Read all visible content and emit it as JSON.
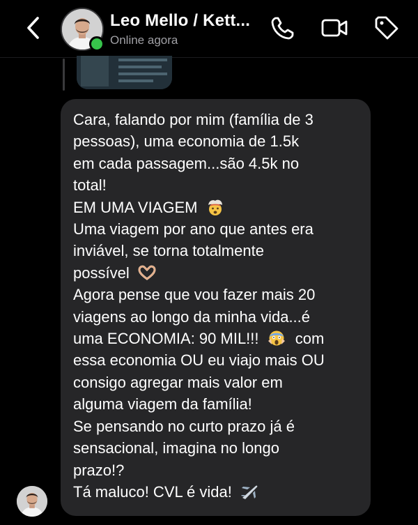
{
  "header": {
    "contact_name": "Leo Mello / Kett...",
    "status": "Online agora"
  },
  "message": {
    "lines": [
      "Cara, falando por mim (família de 3",
      "pessoas), uma economia de 1.5k",
      "em cada passagem...são 4.5k no",
      "total!",
      "EM UMA VIAGEM",
      "Uma viagem por ano que antes era",
      "inviável, se torna totalmente",
      "possível",
      "Agora pense que vou fazer mais 20",
      "viagens ao longo da minha vida...é",
      "uma ECONOMIA: 90 MIL!!!",
      "com",
      "essa economia OU eu viajo mais OU",
      "consigo agregar mais valor em",
      "alguma viagem da família!",
      "Se pensando no curto prazo já é",
      "sensacional, imagina no longo",
      "prazo!?",
      "Tá maluco! CVL é vida!"
    ]
  },
  "icons": {
    "back": "chevron-left-icon",
    "call": "phone-icon",
    "video": "video-camera-icon",
    "tag": "tag-icon",
    "emoji_1": "exploding-head-emoji",
    "emoji_2": "heart-hands-emoji",
    "emoji_3": "screaming-face-emoji",
    "emoji_4": "airplane-emoji"
  },
  "colors": {
    "background": "#000000",
    "bubble": "#262628",
    "online": "#37c34b",
    "secondary_text": "#a0a0a5"
  }
}
